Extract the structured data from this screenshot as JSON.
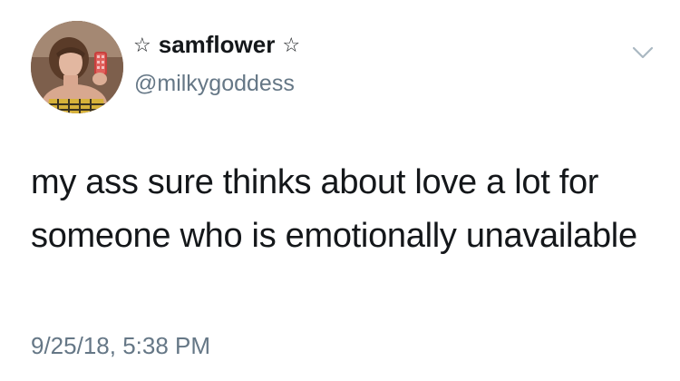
{
  "user": {
    "display_name": "samflower",
    "star_left": "☆",
    "star_right": "☆",
    "handle": "@milkygoddess"
  },
  "tweet": {
    "text": "my ass sure thinks about love a lot for someone who is emotionally unavailable",
    "timestamp": "9/25/18, 5:38 PM"
  },
  "icons": {
    "menu": "chevron-down-icon",
    "avatar": "profile-photo"
  },
  "colors": {
    "text_primary": "#14171a",
    "text_secondary": "#657786",
    "background": "#ffffff"
  }
}
